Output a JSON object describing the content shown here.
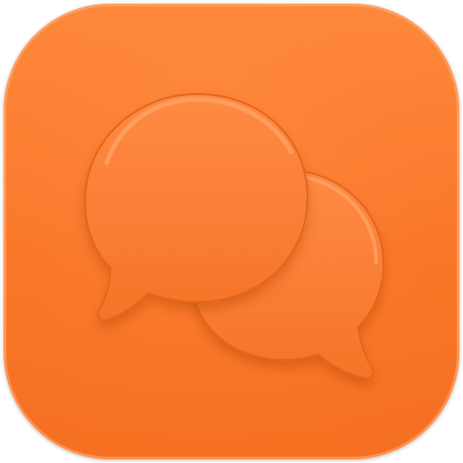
{
  "app_icon": {
    "icon": "chat-bubbles-icon",
    "colors": {
      "tile_light": "#FF8A3D",
      "tile_base": "#F97528",
      "tile_edge": "#E8641A",
      "bubble_fill": "#F87A2E",
      "bubble_highlight": "#FF9C5E",
      "bubble_shadow": "#D95A14"
    }
  }
}
